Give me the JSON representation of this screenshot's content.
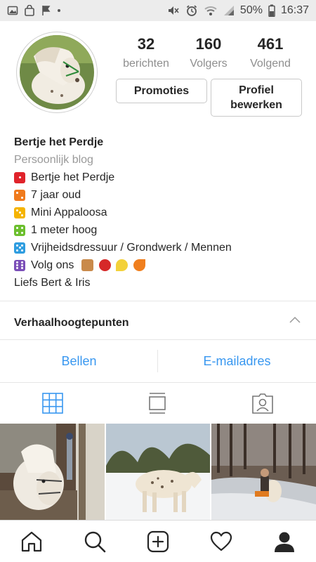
{
  "status_bar": {
    "battery": "50%",
    "time": "16:37",
    "icons_left": [
      "image-icon",
      "shopping-bag-icon",
      "flag-icon",
      "dot-icon"
    ],
    "icons_right": [
      "mute-icon",
      "alarm-icon",
      "wifi-icon",
      "signal-icon",
      "battery-icon"
    ]
  },
  "profile": {
    "stats": [
      {
        "value": "32",
        "label": "berichten"
      },
      {
        "value": "160",
        "label": "Volgers"
      },
      {
        "value": "461",
        "label": "Volgend"
      }
    ],
    "promotions_label": "Promoties",
    "edit_profile_label": "Profiel\nbewerken"
  },
  "bio": {
    "name": "Bertje het Perdje",
    "category": "Persoonlijk blog",
    "lines": [
      {
        "text": "Bertje het Perdje",
        "die_color": "#e0232b"
      },
      {
        "text": "7 jaar oud",
        "die_color": "#f07a1c"
      },
      {
        "text": "Mini Appaloosa",
        "die_color": "#f5b400"
      },
      {
        "text": "1 meter hoog",
        "die_color": "#6cbf2e"
      },
      {
        "text": "Vrijheidsdressuur / Grondwerk /  Mennen",
        "die_color": "#2f9de0"
      },
      {
        "text": "Volg ons",
        "die_color": "#7b4fb8"
      }
    ],
    "signoff": "Liefs Bert & Iris"
  },
  "highlights": {
    "title": "Verhaalhoogtepunten"
  },
  "contact": {
    "call_label": "Bellen",
    "email_label": "E-mailadres"
  },
  "tabs": [
    "grid-icon",
    "feed-icon",
    "tagged-icon"
  ],
  "nav": [
    "home-icon",
    "search-icon",
    "add-icon",
    "heart-icon",
    "profile-icon"
  ],
  "colors": {
    "accent": "#3897f0",
    "muted": "#8e8e8e"
  }
}
